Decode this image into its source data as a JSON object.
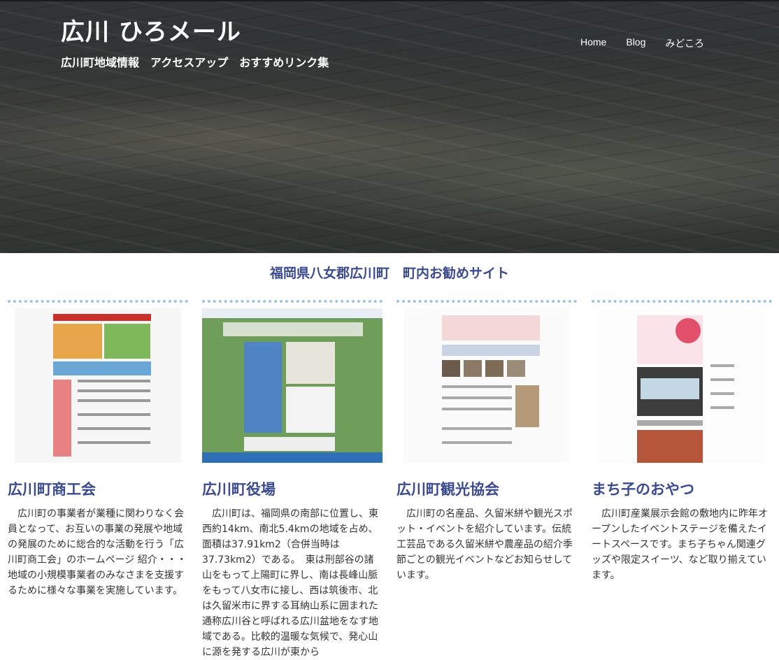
{
  "header": {
    "site_title": "広川 ひろメール",
    "tagline": "広川町地域情報　アクセスアップ　おすすめリンク集",
    "nav": [
      "Home",
      "Blog",
      "みどころ"
    ]
  },
  "section": {
    "title": "福岡県八女郡広川町　町内お勧めサイト"
  },
  "cards": [
    {
      "title": "広川町商工会",
      "text": "広川町の事業者が業種に関わりなく会員となって、お互いの事業の発展や地域の発展のために総合的な活動を行う「広川町商工会」のホームページ 紹介・・・　地域の小規模事業者のみなさまを支援するために様々な事業を実施しています。"
    },
    {
      "title": "広川町役場",
      "text": "広川町は、福岡県の南部に位置し、東西約14km、南北5.4kmの地域を占め、面積は37.91km2（合併当時は37.73km2）である。　東は刑部谷の諸山をもって上陽町に界し、南は長峰山脈をもって八女市に接し、西は筑後市、北は久留米市に界する耳納山系に囲まれた通称広川谷と呼ばれる広川盆地をなす地域である。比較的温暖な気候で、発心山に源を発する広川が東から"
    },
    {
      "title": "広川町観光協会",
      "text": "広川町の名産品、久留米絣や観光スポット・イベントを紹介しています。伝統工芸品である久留米絣や農産品の紹介季節ごとの観光イベントなどお知らせしています。"
    },
    {
      "title": "まち子のおやつ",
      "text": "広川町産業展示会館の敷地内に昨年オープンしたイベントステージを備えたイートスペースです。まち子ちゃん関連グッズや限定スイーツ、など取り揃えています。"
    }
  ],
  "colors": {
    "heading": "#3b4a8f",
    "thumb_border": "#9bc4d9"
  }
}
